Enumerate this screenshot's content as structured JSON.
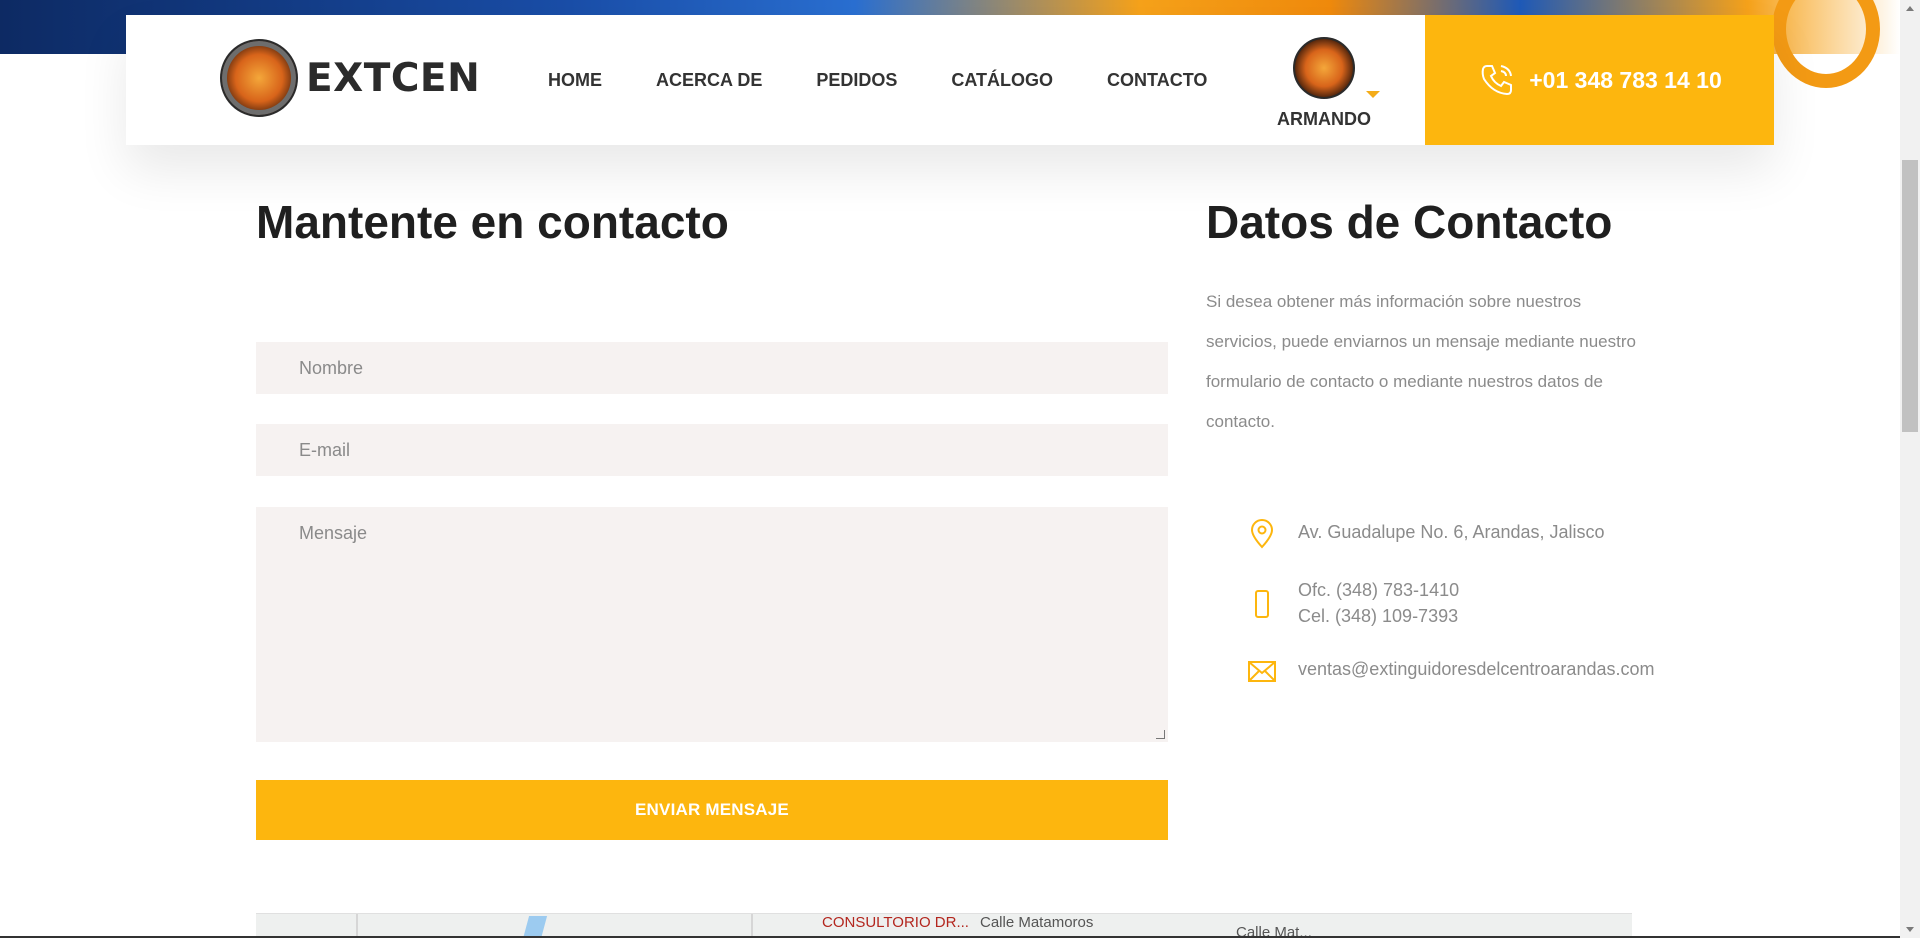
{
  "header": {
    "brand": "EXTCEN",
    "nav": [
      "HOME",
      "ACERCA DE",
      "PEDIDOS",
      "CATÁLOGO",
      "CONTACTO"
    ],
    "user_name": "ARMANDO",
    "phone": "+01 348 783 14 10"
  },
  "form": {
    "title": "Mantente en contacto",
    "name_placeholder": "Nombre",
    "email_placeholder": "E-mail",
    "message_placeholder": "Mensaje",
    "submit_label": "ENVIAR MENSAJE"
  },
  "contact": {
    "title": "Datos de Contacto",
    "intro": "Si desea obtener más información sobre nuestros servicios, puede enviarnos un mensaje mediante nuestro formulario de contacto o mediante nuestros datos de contacto.",
    "address": "Av. Guadalupe No. 6, Arandas, Jalisco",
    "office_phone": "Ofc. (348) 783-1410",
    "cell_phone": "Cel. (348) 109-7393",
    "email": "ventas@extinguidoresdelcentroarandas.com"
  },
  "map": {
    "label_place": "CONSULTORIO DR...",
    "label_street": "Calle Matamoros",
    "label_street_short": "Calle Mat..."
  },
  "colors": {
    "accent": "#fdb60e",
    "text_dark": "#1f1f1f",
    "text_muted": "#8b8b8b",
    "field_bg": "#f6f2f1"
  },
  "icons": [
    "phone-icon",
    "location-pin-icon",
    "mobile-phone-icon",
    "envelope-icon",
    "caret-down-icon"
  ]
}
